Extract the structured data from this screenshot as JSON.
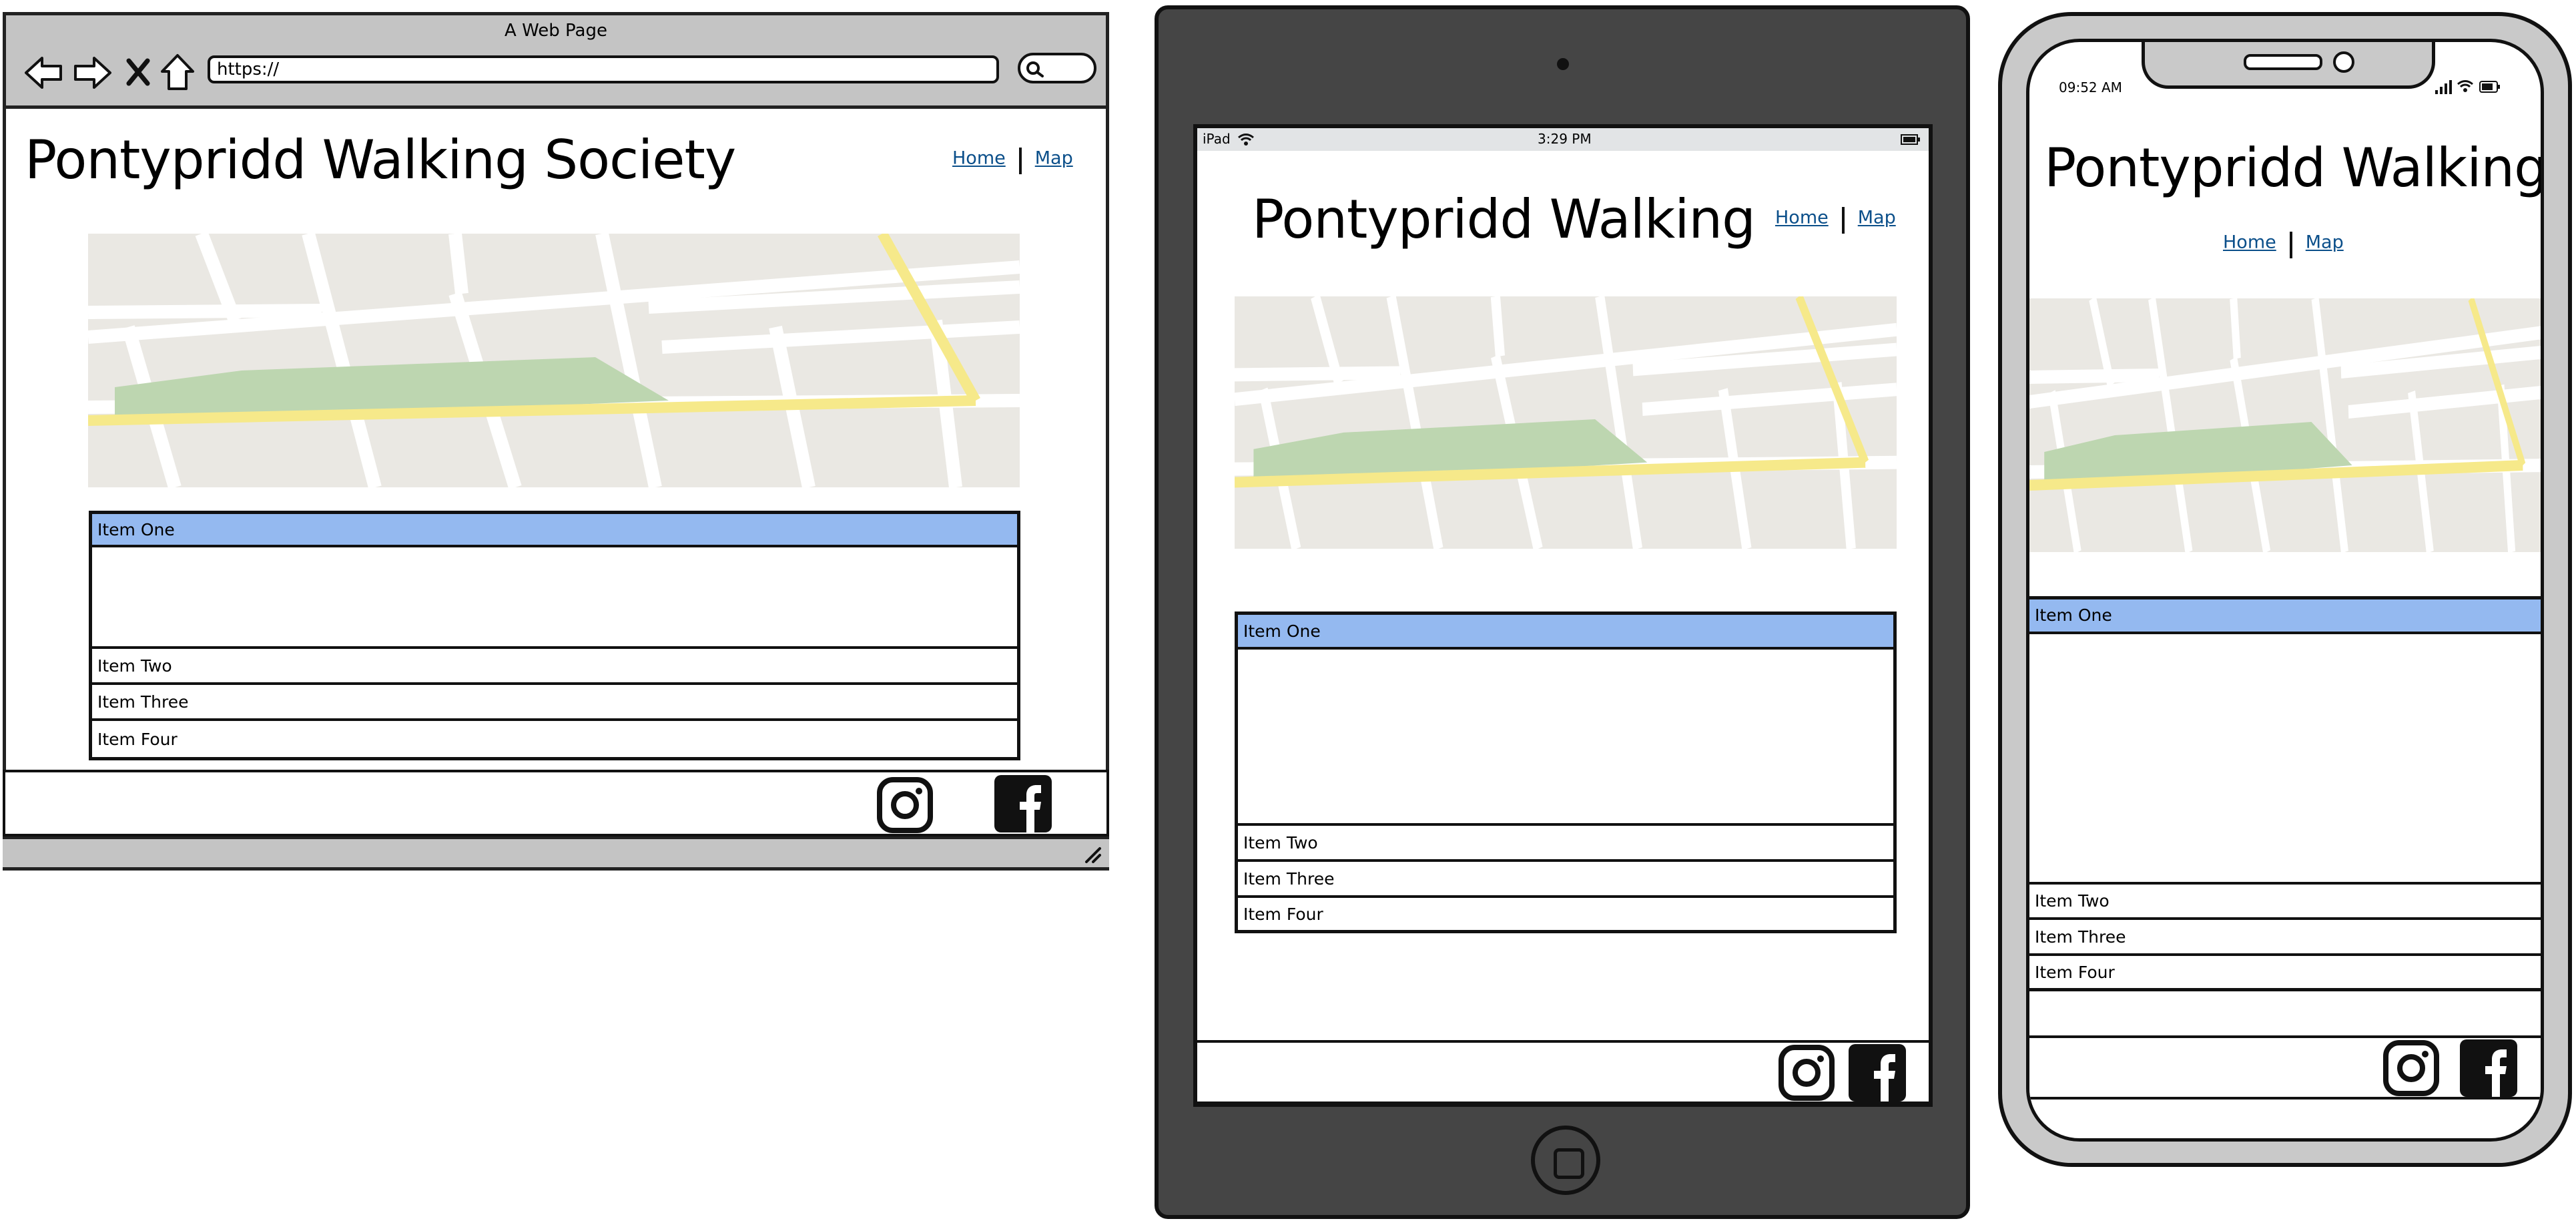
{
  "browser": {
    "window_title": "A Web Page",
    "url": "https://",
    "nav_icons": [
      "back-arrow-icon",
      "forward-arrow-icon",
      "close-icon",
      "home-icon"
    ],
    "search_icon": "search-icon"
  },
  "desktop": {
    "site_title": "Pontypridd Walking Society",
    "nav": {
      "home": "Home",
      "map": "Map"
    },
    "accordion": [
      "Item One",
      "Item Two",
      "Item Three",
      "Item Four"
    ],
    "social": [
      "instagram-icon",
      "facebook-icon"
    ]
  },
  "tablet": {
    "status": {
      "device": "iPad",
      "time": "3:29 PM"
    },
    "site_title": "Pontypridd Walking",
    "nav": {
      "home": "Home",
      "map": "Map"
    },
    "accordion": [
      "Item One",
      "Item Two",
      "Item Three",
      "Item Four"
    ],
    "social": [
      "instagram-icon",
      "facebook-icon"
    ]
  },
  "phone": {
    "status": {
      "time": "09:52 AM"
    },
    "site_title": "Pontypridd Walking",
    "nav": {
      "home": "Home",
      "map": "Map"
    },
    "accordion": [
      "Item One",
      "Item Two",
      "Item Three",
      "Item Four"
    ],
    "social": [
      "instagram-icon",
      "facebook-icon"
    ]
  },
  "colors": {
    "accordion_active": "#94b9f0",
    "map_land": "#eae8e3",
    "map_park": "#bdd6b0",
    "map_route": "#f6e98a",
    "chrome_gray": "#c4c4c4",
    "device_dark": "#454545"
  }
}
